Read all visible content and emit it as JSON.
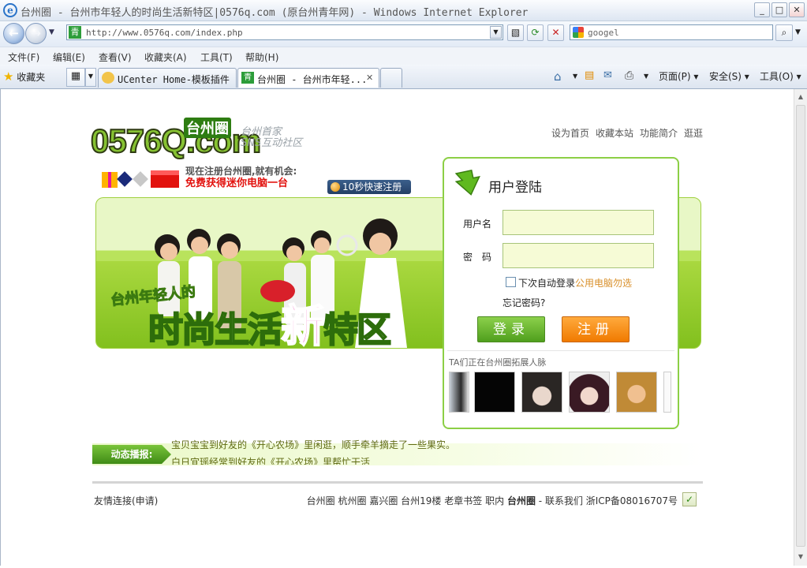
{
  "window": {
    "title": "台州圈 - 台州市年轻人的时尚生活新特区|0576q.com (原台州青年网) - Windows Internet Explorer",
    "controls": {
      "minimize": "_",
      "maximize": "□",
      "close": "✕"
    }
  },
  "navbar": {
    "url": "http://www.0576q.com/index.php",
    "favicon_char": "青",
    "search_text": "googel"
  },
  "menu": [
    "文件(F)",
    "编辑(E)",
    "查看(V)",
    "收藏夹(A)",
    "工具(T)",
    "帮助(H)"
  ],
  "tabs": {
    "favorites_label": "收藏夹",
    "items": [
      {
        "label": "UCenter Home-模板插件 ...",
        "icon": "ucenter-icon"
      },
      {
        "label": "台州圈 - 台州市年轻...",
        "icon": "site-favicon",
        "icon_char": "青"
      }
    ],
    "close_char": "✕"
  },
  "commandbar": {
    "page": "页面(P)",
    "safety": "安全(S)",
    "tools": "工具(O)"
  },
  "page": {
    "logo_main": "0576Q.com",
    "logo_chip": "台州圈",
    "tagline_line1": "台州首家",
    "tagline_line2": "SNS互动社区",
    "top_links": [
      "设为首页",
      "收藏本站",
      "功能简介",
      "逛逛"
    ],
    "promo_line1": "现在注册台州圈,就有机会:",
    "promo_line2": "免费获得迷你电脑一台",
    "quick_register": "10秒快速注册",
    "slogan_small": "台州年轻人的",
    "slogan_a": "时尚生活",
    "slogan_b": "新",
    "slogan_c": "特区"
  },
  "login": {
    "title": "用户登陆",
    "username_label": "用户名",
    "password_label": "密　码",
    "remember_label": "下次自动登录",
    "remember_warning": "公用电脑勿选",
    "forgot": "忘记密码?",
    "login_button": "登录",
    "register_button": "注册",
    "members_title": "TA们正在台州圈拓展人脉"
  },
  "news": {
    "label": "动态播报:",
    "line1": "宝贝宝宝到好友的《开心农场》里闲逛，顺手牵羊摘走了一些果实。",
    "line2": "白日宜瑶经常到好友的《开心农场》里帮忙干活"
  },
  "footer": {
    "friend_links": "友情连接(申请)",
    "links": [
      "台州圈",
      "杭州圈",
      "嘉兴圈",
      "台州19楼",
      "老章书签",
      "职内"
    ],
    "brand": "台州圈",
    "contact": "- 联系我们 浙ICP备08016707号"
  },
  "colors": {
    "accent_green": "#7fc636",
    "register_orange": "#f07a00",
    "promo_red": "#e2120e"
  }
}
